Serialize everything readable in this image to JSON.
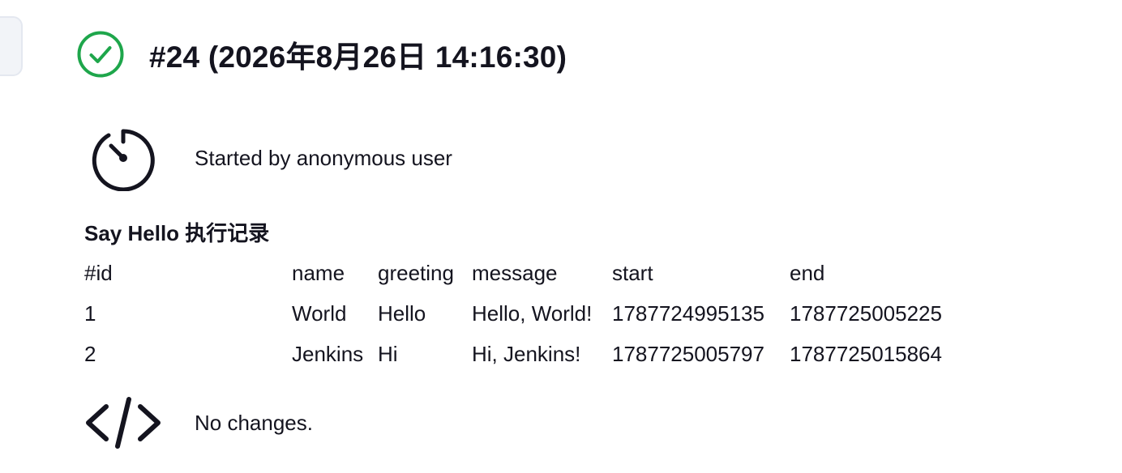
{
  "build": {
    "title": "#24 (2026年8月26日 14:16:30)",
    "status": "success",
    "status_icon": "check-circle-icon",
    "status_color": "#1ea64b"
  },
  "started": {
    "icon": "timer-icon",
    "text": "Started by anonymous user"
  },
  "records": {
    "title": "Say Hello 执行记录",
    "columns": [
      "#id",
      "name",
      "greeting",
      "message",
      "start",
      "end"
    ],
    "rows": [
      [
        "1",
        "World",
        "Hello",
        "Hello, World!",
        "1787724995135",
        "1787725005225"
      ],
      [
        "2",
        "Jenkins",
        "Hi",
        "Hi, Jenkins!",
        "1787725005797",
        "1787725015864"
      ]
    ]
  },
  "changes": {
    "icon": "code-icon",
    "text": "No changes."
  }
}
